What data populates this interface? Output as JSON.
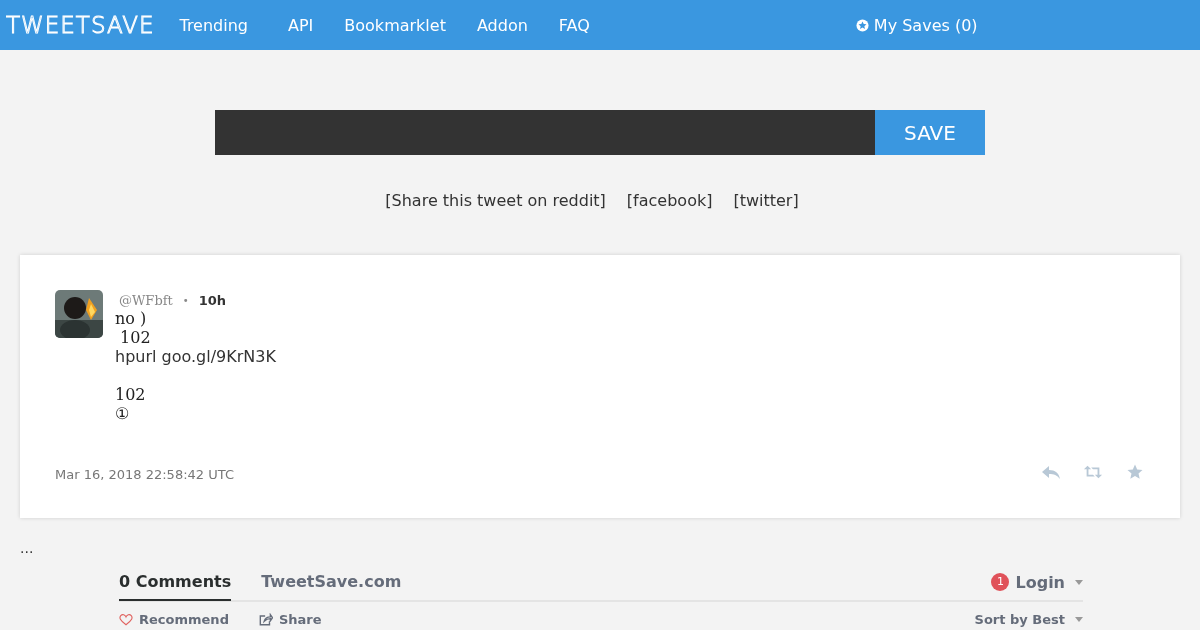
{
  "nav": {
    "logo": "TWEETSAVE",
    "links": [
      "Trending",
      "API",
      "Bookmarklet",
      "Addon",
      "FAQ"
    ],
    "my_saves": "My Saves (0)"
  },
  "save_form": {
    "button": "SAVE"
  },
  "share_links": [
    "[Share this tweet on reddit]",
    "[facebook]",
    "[twitter]"
  ],
  "tweet": {
    "handle": "@WFbft",
    "separator": "•",
    "age": "10h",
    "lines": [
      {
        "text": "no )",
        "kind": "serif"
      },
      {
        "text": " 102",
        "kind": "serif"
      },
      {
        "text": "hpurl goo.gl/9KrN3K",
        "kind": "link"
      },
      {
        "kind": "blank"
      },
      {
        "text": "102",
        "kind": "serif"
      },
      {
        "text": "①",
        "kind": "serif"
      }
    ],
    "timestamp": "Mar 16, 2018 22:58:42 UTC"
  },
  "ellipsis": "...",
  "comments": {
    "tabs": [
      {
        "label": "0 Comments",
        "selected": true
      },
      {
        "label": "TweetSave.com",
        "selected": false
      }
    ],
    "notification_count": "1",
    "login": "Login",
    "recommend": "Recommend",
    "share": "Share",
    "sort": "Sort by Best"
  }
}
